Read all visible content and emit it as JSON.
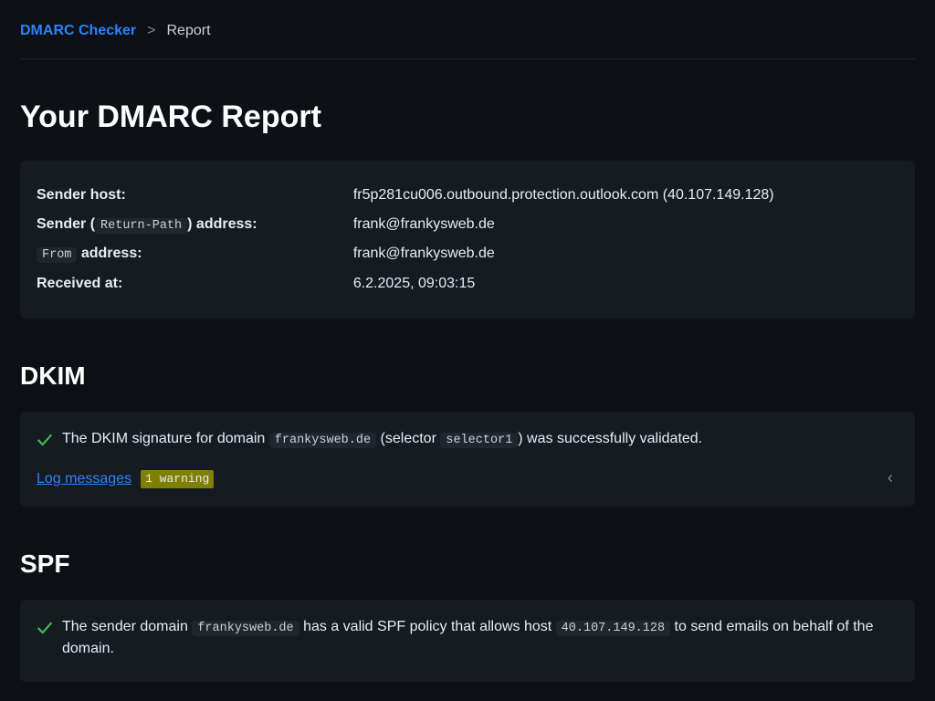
{
  "breadcrumb": {
    "link": "DMARC Checker",
    "sep": ">",
    "current": "Report"
  },
  "page_title": "Your DMARC Report",
  "info": {
    "sender_host_label": "Sender host:",
    "sender_host_value": "fr5p281cu006.outbound.protection.outlook.com (40.107.149.128)",
    "sender_addr_label_pre": "Sender (",
    "sender_addr_label_code": "Return-Path",
    "sender_addr_label_post": ") address:",
    "sender_addr_value": "frank@frankysweb.de",
    "from_addr_code": "From",
    "from_addr_label_post": " address:",
    "from_addr_value": "frank@frankysweb.de",
    "received_label": "Received at:",
    "received_value": "6.2.2025, 09:03:15"
  },
  "dkim": {
    "heading": "DKIM",
    "msg_pre": "The DKIM signature for domain ",
    "msg_domain": "frankysweb.de",
    "msg_mid1": " (selector ",
    "msg_selector": "selector1",
    "msg_post": ") was successfully validated.",
    "log_link": "Log messages",
    "warning_badge": "1 warning"
  },
  "spf": {
    "heading": "SPF",
    "msg_pre": "The sender domain ",
    "msg_domain": "frankysweb.de",
    "msg_mid": " has a valid SPF policy that allows host ",
    "msg_ip": "40.107.149.128",
    "msg_post": " to send emails on behalf of the domain."
  }
}
